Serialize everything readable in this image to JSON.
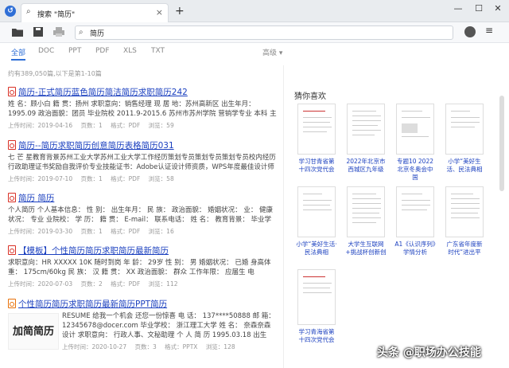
{
  "tab": {
    "title": "搜索 \"简历\"",
    "close": "×"
  },
  "window": {
    "minimize": "—",
    "maximize": "☐",
    "close": "✕",
    "new_tab": "+"
  },
  "search": {
    "value": "简历"
  },
  "filters": [
    "全部",
    "DOC",
    "PPT",
    "PDF",
    "XLS",
    "TXT"
  ],
  "advanced": "高级 ▾",
  "summary": "约有389,050篇,以下是第1-10篇",
  "results": [
    {
      "title": "简历-正式简历蓝色简历简洁简历求职简历242",
      "desc": "姓 名：顾小白 籍 贯：扬州 求职意向：销售经理 现 居 地：苏州高新区 出生年月：1995.09 政治面貌：团员 毕业院校 2011.9-2015.6 苏州市苏州学院 营销学专业 本科 主修课程：西方经",
      "date": "上传时间：2019-04-16",
      "pages": "页数：1",
      "format": "格式：PDF",
      "views": "浏览：59"
    },
    {
      "title": "简历--简历求职简历创意简历表格简历031",
      "desc": "七 芒 星教育背景苏州工业大学苏州工业大学工作经历策划专员策划专员策划专员校内经历行政助理证书奖励自我评价专业技能证书：Adobe认证设计师资质，WPS年度最佳设计师活动荣誉奖",
      "date": "上传时间：2019-07-10",
      "pages": "页数：1",
      "format": "格式：PDF",
      "views": "浏览：58"
    },
    {
      "title": "简历 简历",
      "desc": "个人简历 个人基本信息： 性 别： 出生年月： 民 族： 政治面貌： 婚姻状况： 业： 健康状况： 专业 业院校： 学 历： 籍 贯： E-mail： 联系电话： 姓 名： 教育背景： 毕业学校：城",
      "date": "上传时间：2019-03-30",
      "pages": "页数：1",
      "format": "格式：PDF",
      "views": "浏览：16"
    },
    {
      "title": "【模板】个性简历简历求职简历最新简历",
      "desc": "求职意向：HR XXXXX 10K 随时到岗 年 龄： 29岁 性 别： 男 婚姻状况： 已婚 身高体重： 175cm/60kg 民 族： 汉 籍 贯： XX 政治面貌： 群众 工作年限： 应届生 电",
      "date": "上传时间：2020-07-03",
      "pages": "页数：2",
      "format": "格式：PDF",
      "views": "浏览：112"
    },
    {
      "title": "个性简历简历求职简历最新简历PPT简历",
      "thumb": "加简简历",
      "desc": "RESUME 给我一个机会 还您一份惊喜 电 话： 137****50888 邮 箱： 12345678@docer.com 毕业学校： 浙江理工大学 姓 名： 奈森奈森设计 求职意向： 行政人事、文秘助理 个 人 简 历 1995.03.18 出生",
      "date": "上传时间：2020-10-27",
      "pages": "页数：3",
      "format": "格式：PPTX",
      "views": "浏览：128"
    }
  ],
  "panel": {
    "title": "猜你喜欢",
    "cards": [
      {
        "caption": "学习甘青省第十四次党代会"
      },
      {
        "caption": "2022年北京市西城区九年级"
      },
      {
        "caption": "专题10 2022北京冬奥会中国"
      },
      {
        "caption": "小学“美好生活、民法典相"
      },
      {
        "caption": "小学“美好生活·民法典相"
      },
      {
        "caption": "大学生互联网+挑战杯创新创"
      },
      {
        "caption": "A1《认识序列》学情分析"
      },
      {
        "caption": "广东省年度新时代“进出平"
      },
      {
        "caption": "学习青海省第十四次党代会"
      }
    ]
  },
  "watermark": "头条 @职场办公技能",
  "colors": {
    "accent": "#2f6fd6",
    "link": "#1a3fbf",
    "pdf_icon": "#d93025",
    "ppt_icon": "#e8710a"
  }
}
